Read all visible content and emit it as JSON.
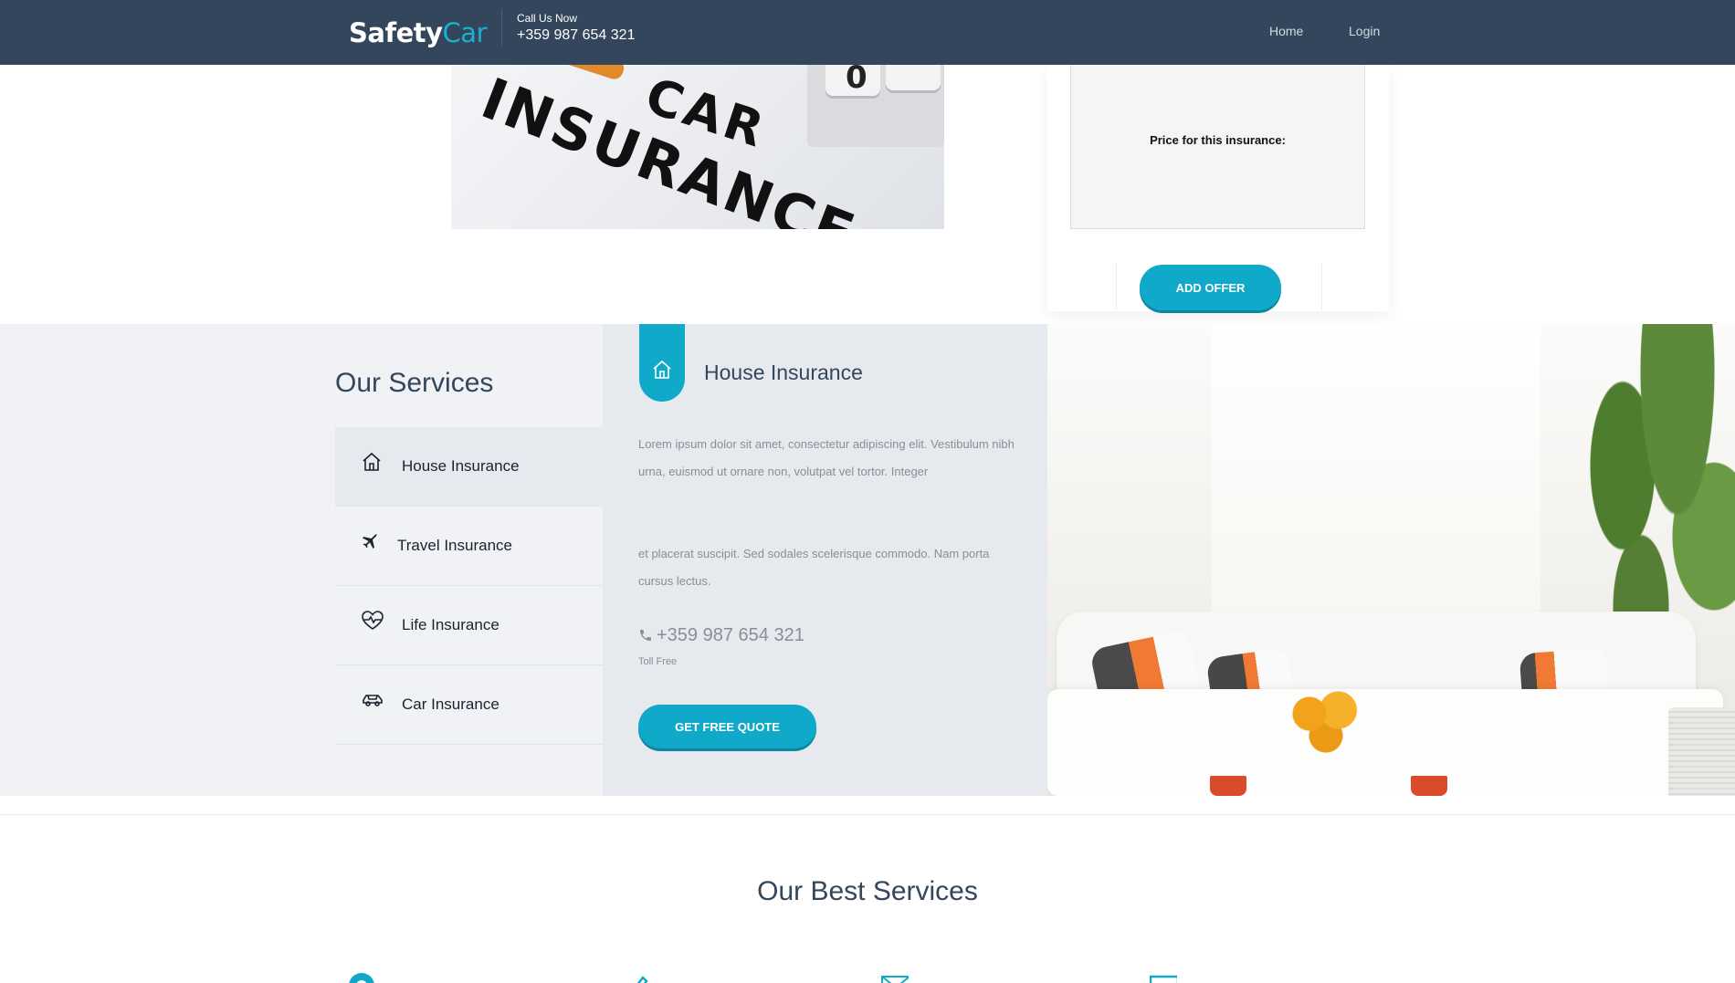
{
  "header": {
    "logo_part1": "Safety",
    "logo_part2": "Car",
    "call_label": "Call Us Now",
    "call_phone": "+359 987 654 321",
    "nav": {
      "home": "Home",
      "login": "Login"
    }
  },
  "hero": {
    "image_text_car": "CAR",
    "image_text_insurance": "INSURANCE",
    "image_calc_key": "0"
  },
  "price_card": {
    "label": "Price for this insurance:",
    "add_offer": "ADD OFFER"
  },
  "services": {
    "title": "Our Services",
    "items": [
      {
        "label": "House Insurance",
        "icon": "house-icon"
      },
      {
        "label": "Travel Insurance",
        "icon": "airplane-icon"
      },
      {
        "label": "Life Insurance",
        "icon": "heartbeat-icon"
      },
      {
        "label": "Car Insurance",
        "icon": "car-icon"
      }
    ],
    "active_index": 0,
    "detail": {
      "title": "House Insurance",
      "paragraph1": "Lorem ipsum dolor sit amet, consectetur adipiscing elit. Vestibulum nibh urna, euismod ut ornare non, volutpat vel tortor. Integer",
      "paragraph2": "et placerat suscipit. Sed sodales scelerisque commodo. Nam porta cursus lectus.",
      "phone": "+359 987 654 321",
      "toll_free": "Toll Free",
      "quote_button": "GET FREE QUOTE"
    }
  },
  "best_services": {
    "title": "Our Best Services",
    "icons": [
      "lifebuoy-icon",
      "pencil-icon",
      "envelope-icon",
      "money-icon"
    ]
  },
  "colors": {
    "header_bg": "#34465c",
    "accent": "#11a9c9",
    "services_bg": "#f0f2f5"
  }
}
